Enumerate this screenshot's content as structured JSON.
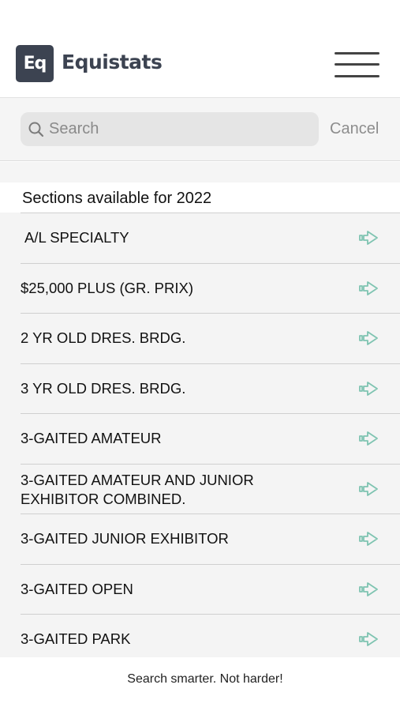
{
  "header": {
    "logo_text": "Eq",
    "app_title": "Equistats",
    "menu_icon": "hamburger-menu-icon"
  },
  "search": {
    "placeholder": "Search",
    "value": "",
    "cancel_label": "Cancel",
    "icon": "search-icon"
  },
  "section_title": "Sections available for 2022",
  "sections": [
    {
      "label": "A/L SPECIALTY"
    },
    {
      "label": "$25,000 PLUS (GR. PRIX)"
    },
    {
      "label": "2 YR OLD DRES. BRDG."
    },
    {
      "label": "3 YR OLD DRES. BRDG."
    },
    {
      "label": "3-GAITED AMATEUR"
    },
    {
      "label": "3-GAITED AMATEUR AND JUNIOR\nEXHIBITOR COMBINED."
    },
    {
      "label": "3-GAITED JUNIOR EXHIBITOR"
    },
    {
      "label": "3-GAITED OPEN"
    },
    {
      "label": "3-GAITED PARK"
    }
  ],
  "row_icon": "arrow-right-icon",
  "colors": {
    "brand": "#3c4351",
    "arrow": "#7fc4b1",
    "list_bg": "#f4f4f4"
  },
  "footer": {
    "tagline": "Search smarter. Not harder!"
  }
}
